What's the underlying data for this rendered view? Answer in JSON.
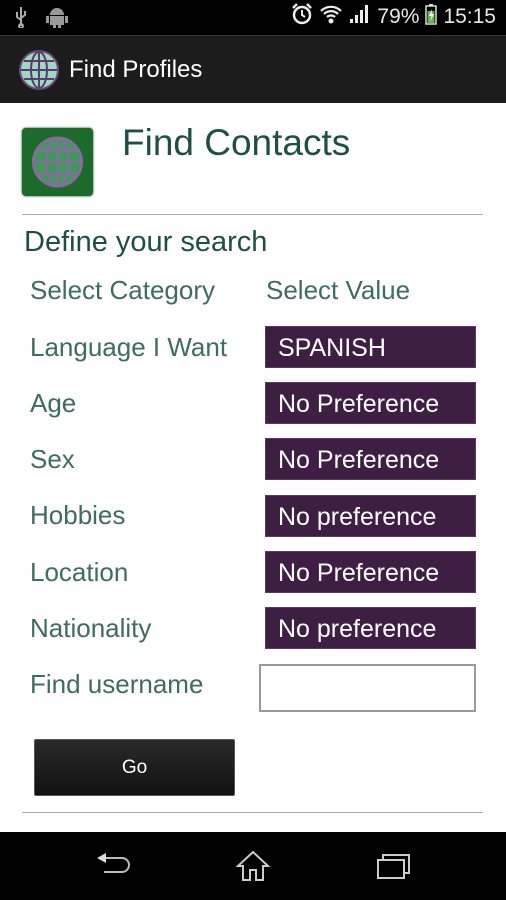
{
  "status_bar": {
    "icons_left": [
      "usb-icon",
      "android-icon"
    ],
    "icons_right": [
      "alarm-icon",
      "wifi-icon",
      "signal-icon",
      "battery-charging-icon"
    ],
    "battery": "79%",
    "time": "15:15"
  },
  "action_bar": {
    "icon": "globe-icon",
    "title": "Find Profiles"
  },
  "header": {
    "icon": "globe-icon",
    "title": "Find Contacts"
  },
  "search": {
    "section_title": "Define your search",
    "column_category": "Select Category",
    "column_value": "Select Value",
    "rows": [
      {
        "label": "Language I Want",
        "value": "SPANISH"
      },
      {
        "label": "Age",
        "value": "No Preference"
      },
      {
        "label": "Sex",
        "value": "No Preference"
      },
      {
        "label": "Hobbies",
        "value": "No preference"
      },
      {
        "label": "Location",
        "value": "No Preference"
      },
      {
        "label": "Nationality",
        "value": "No preference"
      }
    ],
    "username_label": "Find username",
    "username_value": "",
    "go_label": "Go"
  },
  "colors": {
    "spinner_bg": "#3e1f43",
    "header_text": "#1f4e4a",
    "label_text": "#3e6b63",
    "icon_bg": "#1d6b2c"
  },
  "nav_bar": {
    "buttons": [
      "back-icon",
      "home-icon",
      "recent-apps-icon"
    ]
  }
}
